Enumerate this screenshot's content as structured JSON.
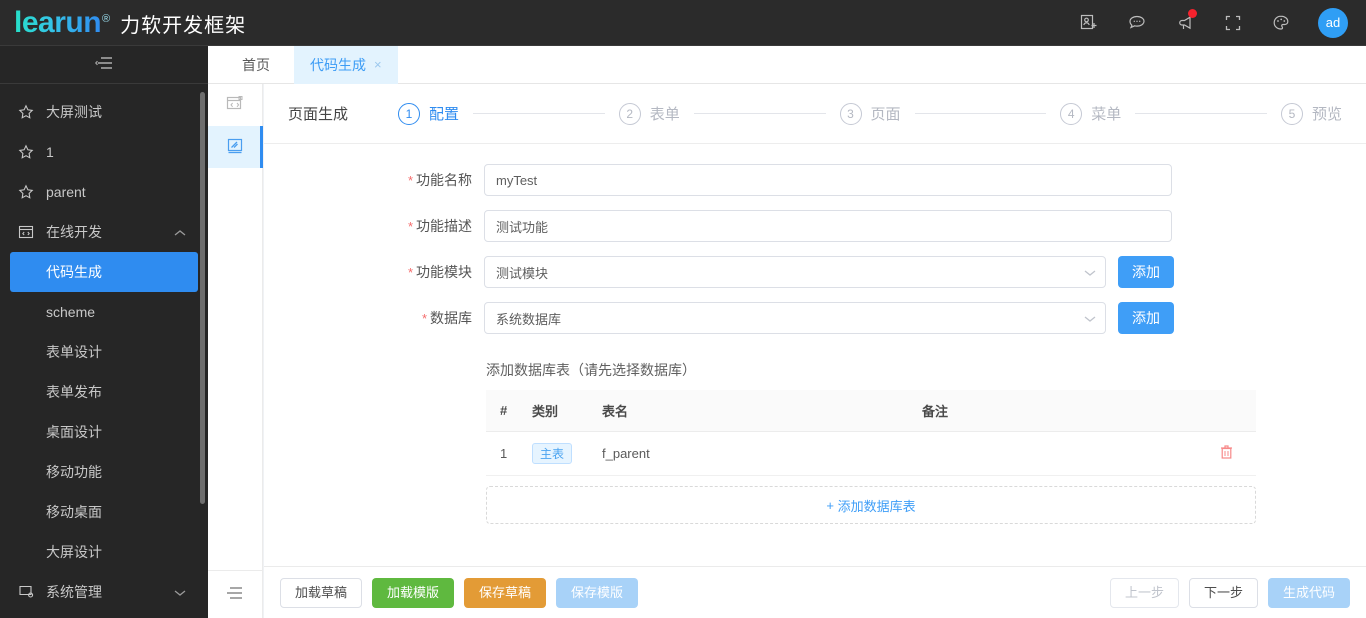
{
  "header": {
    "logo_text": "learun",
    "logo_reg": "®",
    "logo_cn": "力软开发框架",
    "icons": [
      {
        "name": "add-contact-icon"
      },
      {
        "name": "chat-icon"
      },
      {
        "name": "megaphone-icon",
        "badge": true
      },
      {
        "name": "fullscreen-icon"
      },
      {
        "name": "palette-icon"
      }
    ],
    "avatar_label": "ad"
  },
  "sidebar": {
    "collapse_icon": "menu-fold-icon",
    "items": [
      {
        "label": "大屏测试",
        "icon": "star-icon",
        "type": "star"
      },
      {
        "label": "1",
        "icon": "star-icon",
        "type": "star"
      },
      {
        "label": "parent",
        "icon": "star-icon",
        "type": "star"
      },
      {
        "label": "在线开发",
        "icon": "code-window-icon",
        "type": "group",
        "expanded": true,
        "arrow": "chevron-up-icon"
      },
      {
        "label": "代码生成",
        "type": "child",
        "active": true
      },
      {
        "label": "scheme",
        "type": "child"
      },
      {
        "label": "表单设计",
        "type": "child"
      },
      {
        "label": "表单发布",
        "type": "child"
      },
      {
        "label": "桌面设计",
        "type": "child"
      },
      {
        "label": "移动功能",
        "type": "child"
      },
      {
        "label": "移动桌面",
        "type": "child"
      },
      {
        "label": "大屏设计",
        "type": "child"
      },
      {
        "label": "系统管理",
        "icon": "window-settings-icon",
        "type": "group",
        "expanded": false,
        "arrow": "chevron-down-icon"
      }
    ]
  },
  "tabs": [
    {
      "label": "首页",
      "active": false,
      "closable": false
    },
    {
      "label": "代码生成",
      "active": true,
      "closable": true,
      "close_glyph": "×"
    }
  ],
  "rail": {
    "buttons": [
      {
        "name": "code-window-icon",
        "active": false
      },
      {
        "name": "design-pen-icon",
        "active": true
      }
    ],
    "foot_icon": "menu-fold-icon"
  },
  "steps": {
    "title": "页面生成",
    "items": [
      {
        "num": "1",
        "label": "配置",
        "active": true
      },
      {
        "num": "2",
        "label": "表单",
        "active": false
      },
      {
        "num": "3",
        "label": "页面",
        "active": false
      },
      {
        "num": "4",
        "label": "菜单",
        "active": false
      },
      {
        "num": "5",
        "label": "预览",
        "active": false
      }
    ]
  },
  "form": {
    "func_name_label": "功能名称",
    "func_name_value": "myTest",
    "func_desc_label": "功能描述",
    "func_desc_value": "测试功能",
    "func_module_label": "功能模块",
    "func_module_value": "测试模块",
    "func_module_add": "添加",
    "database_label": "数据库",
    "database_value": "系统数据库",
    "database_add": "添加",
    "required_mark": "*",
    "chevron_icon": "chevron-down-icon"
  },
  "table": {
    "title": "添加数据库表（请先选择数据库）",
    "columns": [
      "#",
      "类别",
      "表名",
      "备注",
      ""
    ],
    "rows": [
      {
        "idx": "1",
        "type": "主表",
        "name": "f_parent",
        "note": "",
        "delete_icon": "trash-icon"
      }
    ],
    "add_row_label": "添加数据库表",
    "add_row_plus": "+"
  },
  "footer": {
    "left_buttons": [
      {
        "label": "加载草稿",
        "style": "white"
      },
      {
        "label": "加载模版",
        "style": "green"
      },
      {
        "label": "保存草稿",
        "style": "orange"
      },
      {
        "label": "保存模版",
        "style": "lblue"
      }
    ],
    "right_buttons": [
      {
        "label": "上一步",
        "style": "disabled"
      },
      {
        "label": "下一步",
        "style": "white"
      },
      {
        "label": "生成代码",
        "style": "lblue"
      }
    ]
  },
  "colors": {
    "accent": "#2f8cf0",
    "sidebar_bg": "#262626",
    "topbar_bg": "#2b2b2b",
    "green": "#5fb93f",
    "orange": "#e39b36",
    "light_blue": "#a8d2f8",
    "required_red": "#f56c6c"
  }
}
